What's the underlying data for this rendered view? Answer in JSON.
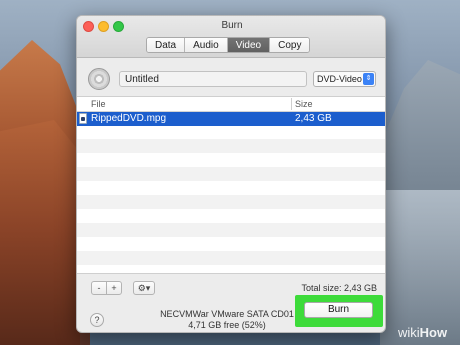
{
  "window": {
    "title": "Burn",
    "tabs": [
      "Data",
      "Audio",
      "Video",
      "Copy"
    ],
    "active_tab": "Video"
  },
  "disc": {
    "name_value": "Untitled",
    "format_value": "DVD-Video"
  },
  "table": {
    "columns": [
      "File",
      "Size"
    ],
    "rows": [
      {
        "file": "RippedDVD.mpg",
        "size": "2,43 GB",
        "selected": true
      }
    ]
  },
  "toolbar": {
    "minus_label": "-",
    "plus_label": "+",
    "gear_label": "⚙▾",
    "total_size": "Total size: 2,43 GB"
  },
  "footer": {
    "help_label": "?",
    "device_name": "NECVMWar VMware SATA CD01",
    "device_free": "4,71 GB free (52%)",
    "burn_label": "Burn"
  },
  "watermark": {
    "wiki": "wiki",
    "how": "How"
  },
  "colors": {
    "selection": "#1c5ecd",
    "highlight": "#3ddb3a",
    "active_tab": "#666666"
  }
}
